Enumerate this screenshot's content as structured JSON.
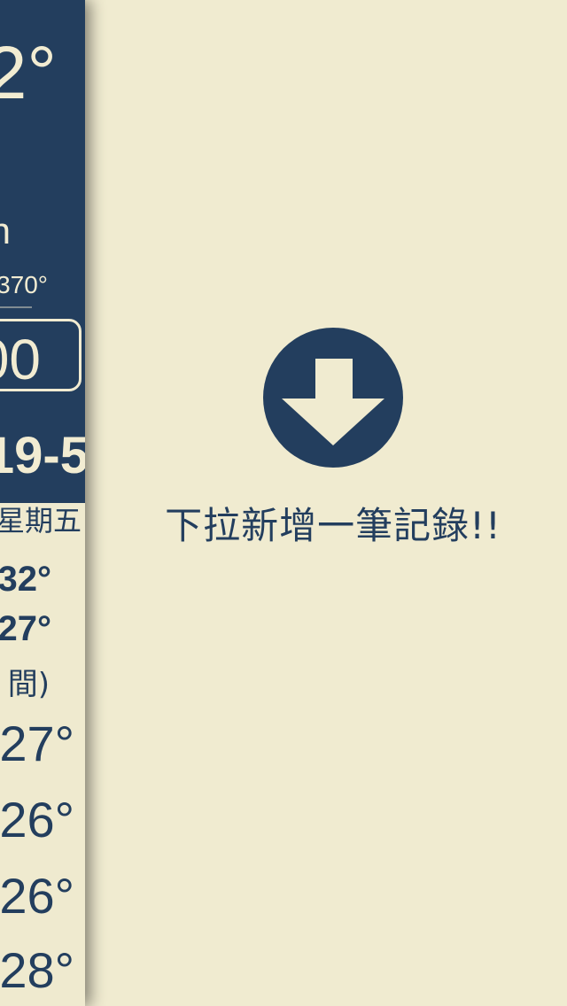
{
  "side_panel": {
    "current_temp": "2°",
    "unit_fragment": "n",
    "small_reading": "370°",
    "boxed_value": "00",
    "date_fragment": "19-5",
    "weekday": "星期五",
    "high_temp": "32°",
    "low_temp": "27°",
    "period_label": "間)",
    "hourly_temps": [
      "27°",
      "26°",
      "26°",
      "28°"
    ]
  },
  "empty_state": {
    "icon": "down-arrow-circle-icon",
    "hint": "下拉新增一筆記錄!!"
  },
  "colors": {
    "background": "#f0ebd0",
    "navy": "#233e5e",
    "cream_text": "#f2ecd2"
  }
}
